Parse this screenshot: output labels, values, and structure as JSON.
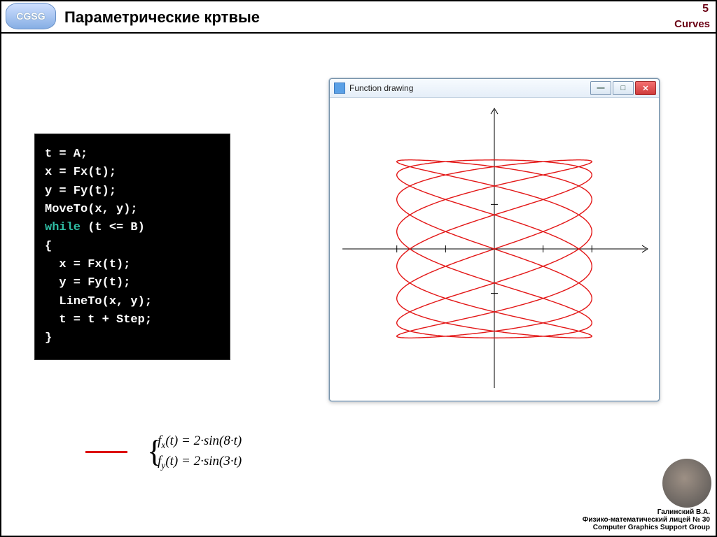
{
  "header": {
    "logo_text": "CGSG",
    "title": "Параметрические кртвые",
    "page_number": "5",
    "section": "Curves"
  },
  "code": {
    "lines": [
      {
        "t": "t = A;"
      },
      {
        "t": "x = Fx(t);"
      },
      {
        "t": "y = Fy(t);"
      },
      {
        "t": "MoveTo(x, y);"
      },
      {
        "t": "while (t <= B)",
        "kw": "while"
      },
      {
        "t": "{"
      },
      {
        "t": "  x = Fx(t);"
      },
      {
        "t": "  y = Fy(t);"
      },
      {
        "t": "  LineTo(x, y);"
      },
      {
        "t": "  t = t + Step;"
      },
      {
        "t": "}"
      }
    ]
  },
  "window": {
    "title": "Function drawing",
    "minimize": "—",
    "maximize": "□",
    "close": "✕",
    "axes": {
      "xmin": -3,
      "xmax": 3,
      "ymin": -3,
      "ymax": 3,
      "ticks": [
        -2,
        -1,
        1,
        2
      ]
    }
  },
  "curve": {
    "fx_coeff": 2,
    "fx_freq": 8,
    "fy_coeff": 2,
    "fy_freq": 3,
    "color": "#e31717",
    "label_fx": "f",
    "sub_x": "x",
    "label_fy": "f",
    "sub_y": "y",
    "arg": "t",
    "eq": " = 2·sin(8·",
    "eq_close": ")",
    "eq2": " = 2·sin(3·",
    "brace": "{"
  },
  "footer": {
    "l1": "Галинский В.А.",
    "l2": "Физико-математический лицей № 30",
    "l3": "Computer Graphics Support Group"
  }
}
